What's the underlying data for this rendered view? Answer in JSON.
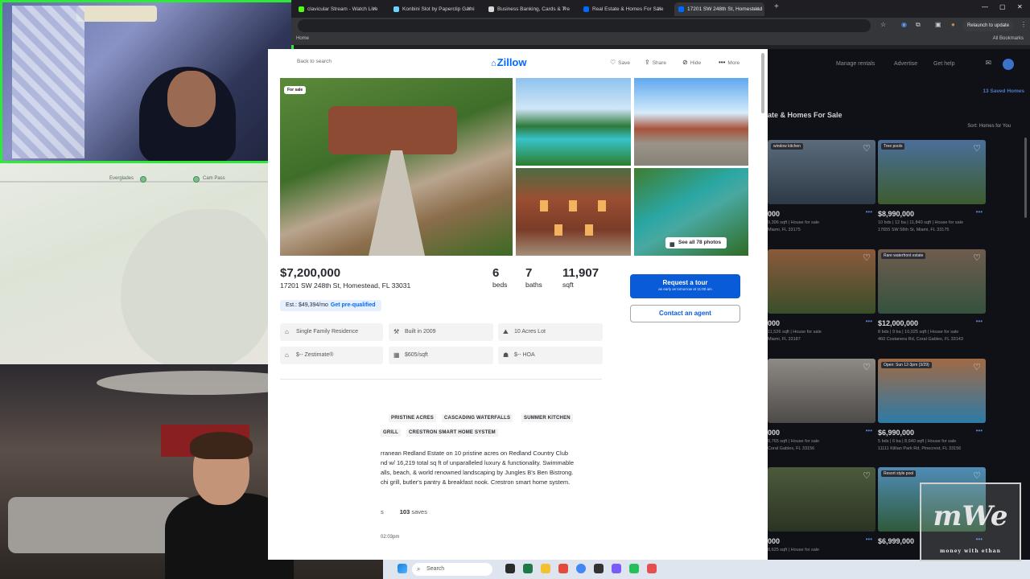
{
  "browser": {
    "tabs": [
      {
        "label": "clavicular Stream - Watch Live",
        "color": "#53fc18"
      },
      {
        "label": "Konbini Slot by Paperclip Gami",
        "color": "#6ad3ff"
      },
      {
        "label": "Business Banking, Cards & Tre",
        "color": "#d9d9d9"
      },
      {
        "label": "Real Estate & Homes For Sale",
        "color": "#006aff"
      },
      {
        "label": "17201 SW 248th St, Homestead",
        "color": "#006aff"
      }
    ],
    "relaunch_label": "Relaunch to update",
    "bookmarks_apps": "Home",
    "bookmarks_all": "All Bookmarks"
  },
  "map": {
    "labels": [
      "Everglades",
      "Cam Pass"
    ]
  },
  "zillow_modal": {
    "back": "Back to search",
    "logo": "Zillow",
    "actions": [
      {
        "icon": "heart-icon",
        "glyph": "♡",
        "label": "Save"
      },
      {
        "icon": "share-icon",
        "glyph": "⇪",
        "label": "Share"
      },
      {
        "icon": "hide-icon",
        "glyph": "⊘",
        "label": "Hide"
      },
      {
        "icon": "more-icon",
        "glyph": "•••",
        "label": "More"
      }
    ],
    "for_sale_badge": "For sale",
    "see_all_photos": "See all 78 photos",
    "price": "$7,200,000",
    "address": "17201 SW 248th St, Homestead, FL 33031",
    "facts": [
      {
        "num": "6",
        "label": "beds"
      },
      {
        "num": "7",
        "label": "baths"
      },
      {
        "num": "11,907",
        "label": "sqft"
      }
    ],
    "est_payment": "Est.: $49,394/mo",
    "prequal": "Get pre-qualified",
    "request_tour": "Request a tour",
    "request_tour_sub": "as early as tomorrow at 11:00 am",
    "contact_agent": "Contact an agent",
    "chips": [
      {
        "icon": "building-icon",
        "glyph": "⌂",
        "label": "Single Family Residence"
      },
      {
        "icon": "hammer-icon",
        "glyph": "⚒",
        "label": "Built in 2009"
      },
      {
        "icon": "lot-icon",
        "glyph": "⛰",
        "label": "10 Acres Lot"
      },
      {
        "icon": "zestimate-icon",
        "glyph": "⌂",
        "label": "$-- Zestimate®"
      },
      {
        "icon": "price-sqft-icon",
        "glyph": "▦",
        "label": "$605/sqft"
      },
      {
        "icon": "hoa-icon",
        "glyph": "☗",
        "label": "$-- HOA"
      }
    ],
    "tags": [
      "PRISTINE ACRES",
      "CASCADING WATERFALLS",
      "SUMMER KITCHEN",
      "GRILL",
      "CRESTRON SMART HOME SYSTEM"
    ],
    "description": [
      "rranean Redland Estate on 10 pristine acres on Redland Country Club",
      "nd w/ 16,219 total sq ft of unparalleled luxury & functionality. Swimmable",
      "alls, beach, & world renowned landscaping by Jungles B's Ben Bistrong.",
      "chi grill, butler's pantry & breakfast nook. Crestron smart home system."
    ],
    "views_tail": "s",
    "saves_count": "103",
    "saves_label": "saves",
    "time": "02:03pm"
  },
  "bg_page": {
    "nav": [
      "Manage rentals",
      "Advertise",
      "Get help"
    ],
    "saved": "13 Saved Homes",
    "title": "ate & Homes For Sale",
    "sort": "Sort: Homes for You",
    "cards": [
      {
        "price": "000",
        "info": "9,396 sqft | House for sale",
        "addr": "Miami, FL 33175",
        "badge": "window kitchen",
        "color1": "#5b6b7c",
        "color2": "#2d3a45"
      },
      {
        "price": "$8,990,000",
        "info": "10 bds | 12 ba | 11,840 sqft | House for sale",
        "addr": "17655 SW 58th St, Miami, FL 33175",
        "badge": "Tree pools",
        "color1": "#4a6f9a",
        "color2": "#3c5c2e"
      },
      {
        "price": "000",
        "info": "11,526 sqft | House for sale",
        "addr": "Miami, FL 33187",
        "badge": "",
        "color1": "#8a5a3c",
        "color2": "#3a4e2a"
      },
      {
        "price": "$12,000,000",
        "info": "8 bds | 9 ba | 10,025 sqft | House for sale",
        "addr": "460 Costanera Rd, Coral Gables, FL 33143",
        "badge": "Rare waterfront estate",
        "color1": "#6f5c4e",
        "color2": "#35523e"
      },
      {
        "price": "000",
        "info": "8,765 sqft | House for sale",
        "addr": "Coral Gables, FL 33156",
        "badge": "",
        "color1": "#8e8a86",
        "color2": "#4d4a47"
      },
      {
        "price": "$6,990,000",
        "info": "5 bds | 6 ba | 8,640 sqft | House for sale",
        "addr": "11111 Killian Park Rd, Pinecrest, FL 33156",
        "badge": "Open: Sun 12-3pm (3/29)",
        "color1": "#a06a45",
        "color2": "#2e7aa6"
      },
      {
        "price": "000",
        "info": "8,625 sqft | House for sale",
        "addr": "",
        "badge": "",
        "color1": "#4b5a3c",
        "color2": "#2b3424"
      },
      {
        "price": "$6,999,000",
        "info": "",
        "addr": "",
        "badge": "Resort style pool",
        "color1": "#4f8cb6",
        "color2": "#2f5a3a"
      }
    ]
  },
  "taskbar": {
    "search": "Search"
  },
  "watermark": {
    "mark": "mWe",
    "sub": "money with ethan"
  }
}
